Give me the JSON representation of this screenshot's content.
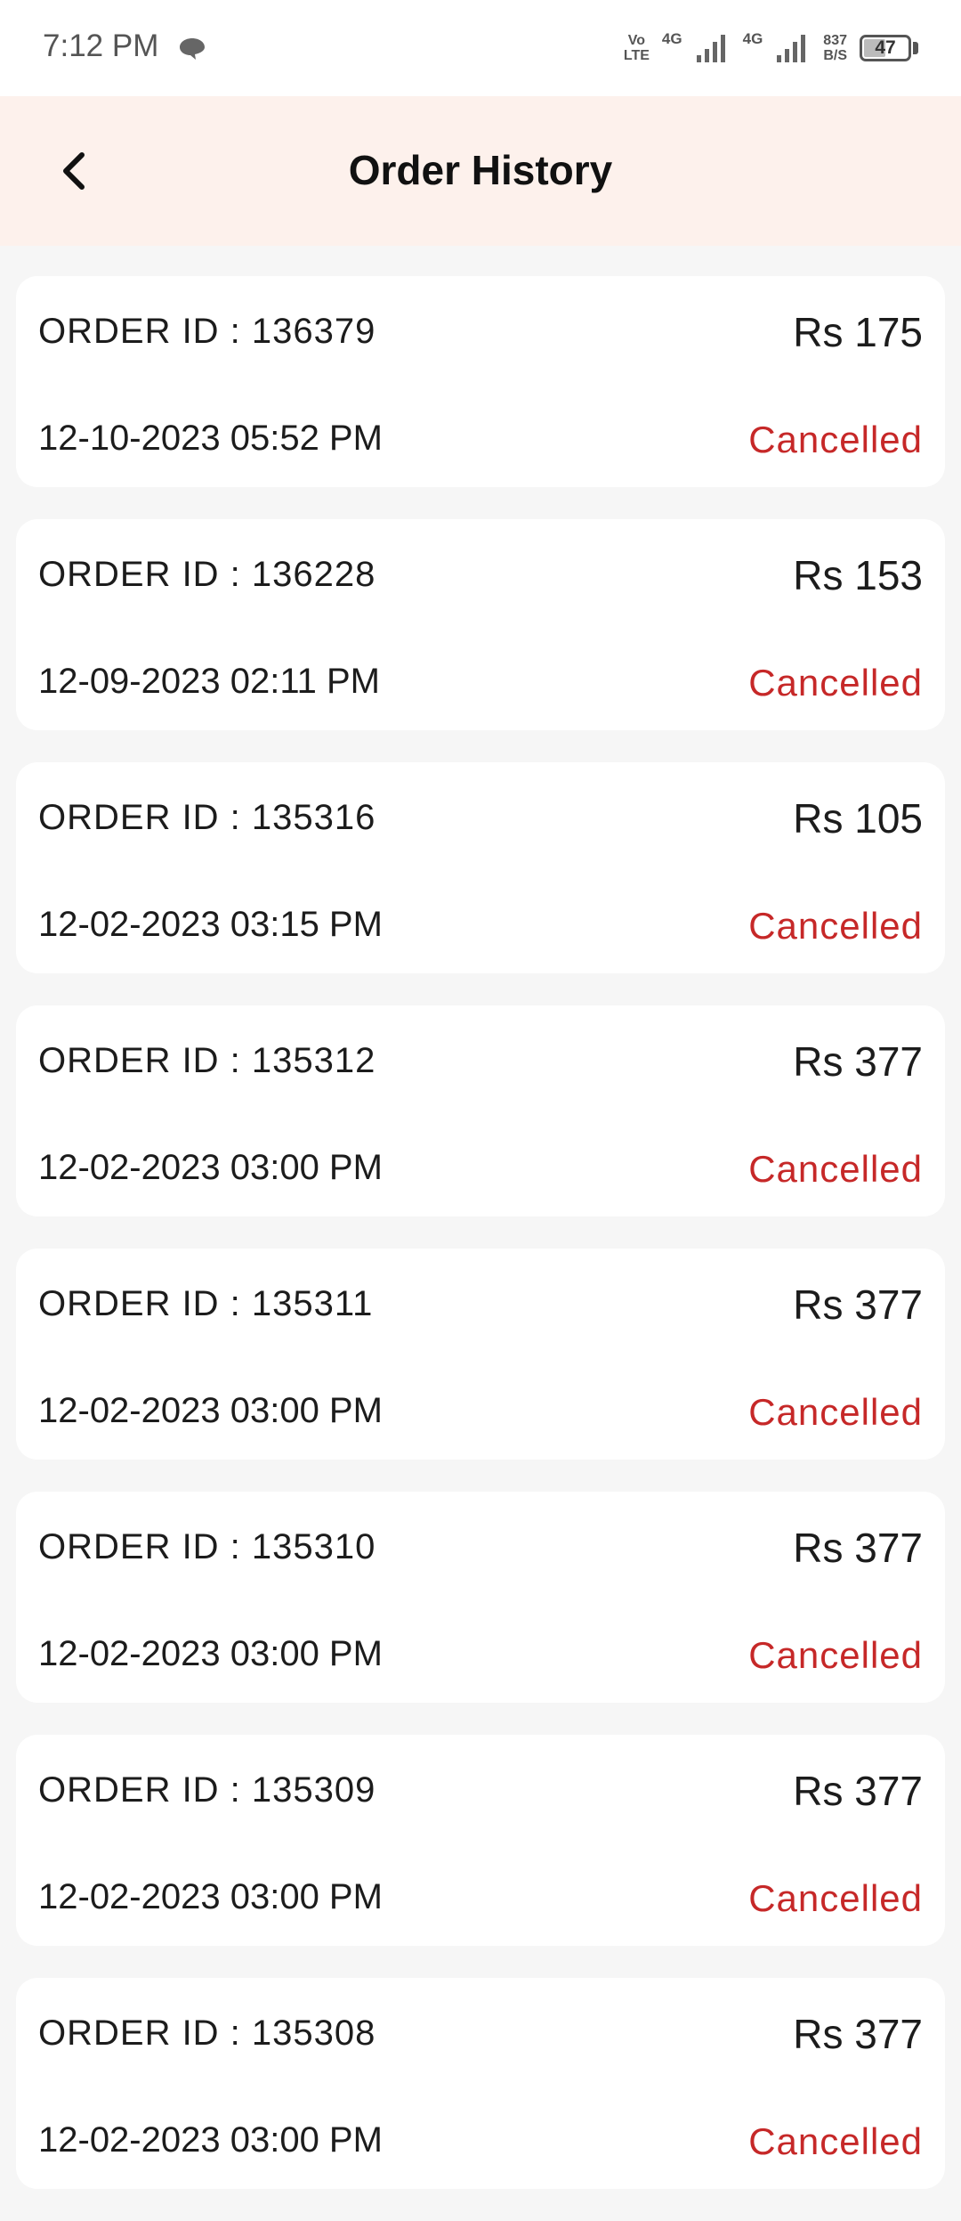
{
  "status_bar": {
    "time": "7:12 PM",
    "volte_top": "Vo",
    "volte_bottom": "LTE",
    "net1": "4G",
    "net2": "4G",
    "speed_top": "837",
    "speed_bottom": "B/S",
    "battery": "47"
  },
  "header": {
    "title": "Order History",
    "back_icon": "chevron-left-icon"
  },
  "colors": {
    "header_bg": "#fdf1ec",
    "status_cancelled": "#c62828"
  },
  "orders": [
    {
      "id_label": "ORDER ID : 136379",
      "amount": "Rs 175",
      "date": "12-10-2023 05:52 PM",
      "status": "Cancelled"
    },
    {
      "id_label": "ORDER ID : 136228",
      "amount": "Rs 153",
      "date": "12-09-2023 02:11 PM",
      "status": "Cancelled"
    },
    {
      "id_label": "ORDER ID : 135316",
      "amount": "Rs 105",
      "date": "12-02-2023 03:15 PM",
      "status": "Cancelled"
    },
    {
      "id_label": "ORDER ID : 135312",
      "amount": "Rs 377",
      "date": "12-02-2023 03:00 PM",
      "status": "Cancelled"
    },
    {
      "id_label": "ORDER ID : 135311",
      "amount": "Rs 377",
      "date": "12-02-2023 03:00 PM",
      "status": "Cancelled"
    },
    {
      "id_label": "ORDER ID : 135310",
      "amount": "Rs 377",
      "date": "12-02-2023 03:00 PM",
      "status": "Cancelled"
    },
    {
      "id_label": "ORDER ID : 135309",
      "amount": "Rs 377",
      "date": "12-02-2023 03:00 PM",
      "status": "Cancelled"
    },
    {
      "id_label": "ORDER ID : 135308",
      "amount": "Rs 377",
      "date": "12-02-2023 03:00 PM",
      "status": "Cancelled"
    }
  ]
}
